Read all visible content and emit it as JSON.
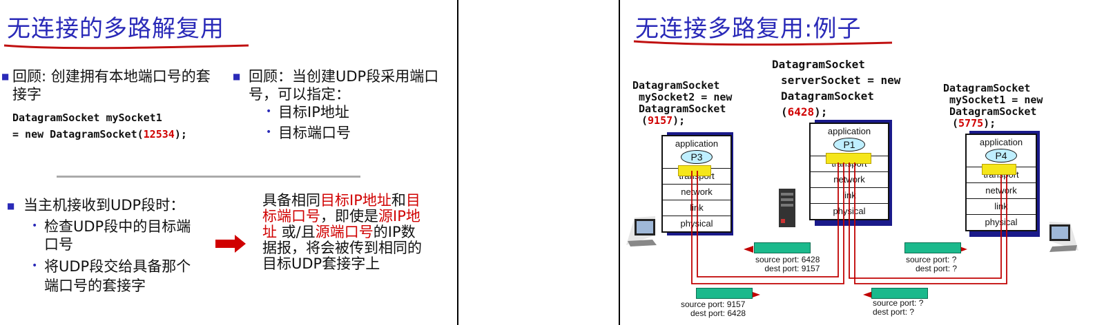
{
  "left": {
    "title": "无连接的多路解复用",
    "bullet1_line1": "回顾: 创建拥有本地端口号的套",
    "bullet1_line2": "接字",
    "code1_line1": "DatagramSocket mySocket1",
    "code1_line2_pre": "= new DatagramSocket(",
    "code1_port": "12534",
    "code1_line2_post": ");",
    "bullet2_line1": "回顾：当创建UDP段采用端口",
    "bullet2_line2": "号，可以指定：",
    "sub1": "目标IP地址",
    "sub2": "目标端口号",
    "bullet3": "当主机接收到UDP段时：",
    "sub3_line1": "检查UDP段中的目标端",
    "sub3_line2": "口号",
    "sub4_line1": "将UDP段交给具备那个",
    "sub4_line2": "端口号的套接字",
    "right_p1": "具备相同",
    "right_p1_red": "目标IP地址",
    "right_p1_b": "和",
    "right_p1_red2": "目",
    "right_p2_red": "标端口号",
    "right_p2_b": "，即使是",
    "right_p2_red2": "源IP地",
    "right_p3_red": "址",
    "right_p3_b": " 或/且",
    "right_p3_red2": "源端口号",
    "right_p3_c": "的IP数",
    "right_p4": "据报，将会被传到相同的",
    "right_p5": "目标UDP套接字上"
  },
  "right": {
    "title": "无连接多路复用:例子",
    "sock_left_1": "DatagramSocket",
    "sock_left_2": "mySocket2 = new",
    "sock_left_3": "DatagramSocket",
    "sock_left_port": "9157",
    "sock_mid_1": "DatagramSocket",
    "sock_mid_2": "serverSocket = new",
    "sock_mid_3": "DatagramSocket",
    "sock_mid_port": "6428",
    "sock_right_1": "DatagramSocket",
    "sock_right_2": "mySocket1 = new",
    "sock_right_3": "DatagramSocket",
    "sock_right_port": "5775",
    "open_paren": "(",
    "close_paren": ");",
    "layers": [
      "application",
      "transport",
      "network",
      "link",
      "physical"
    ],
    "p_left": "P3",
    "p_mid": "P1",
    "p_right": "P4",
    "seg1_src": "source port: 6428",
    "seg1_dst": "dest port: 9157",
    "seg2_src": "source port: ?",
    "seg2_dst": "dest port: ?",
    "seg3_src": "source port: 9157",
    "seg3_dst": "dest port: 6428",
    "seg4_src": "source port: ?",
    "seg4_dst": "dest port: ?"
  },
  "colors": {
    "title": "#2a2ab8",
    "red": "#d00000",
    "segment": "#1bb98c",
    "socket": "#f5e61a",
    "process": "#bfefff"
  }
}
